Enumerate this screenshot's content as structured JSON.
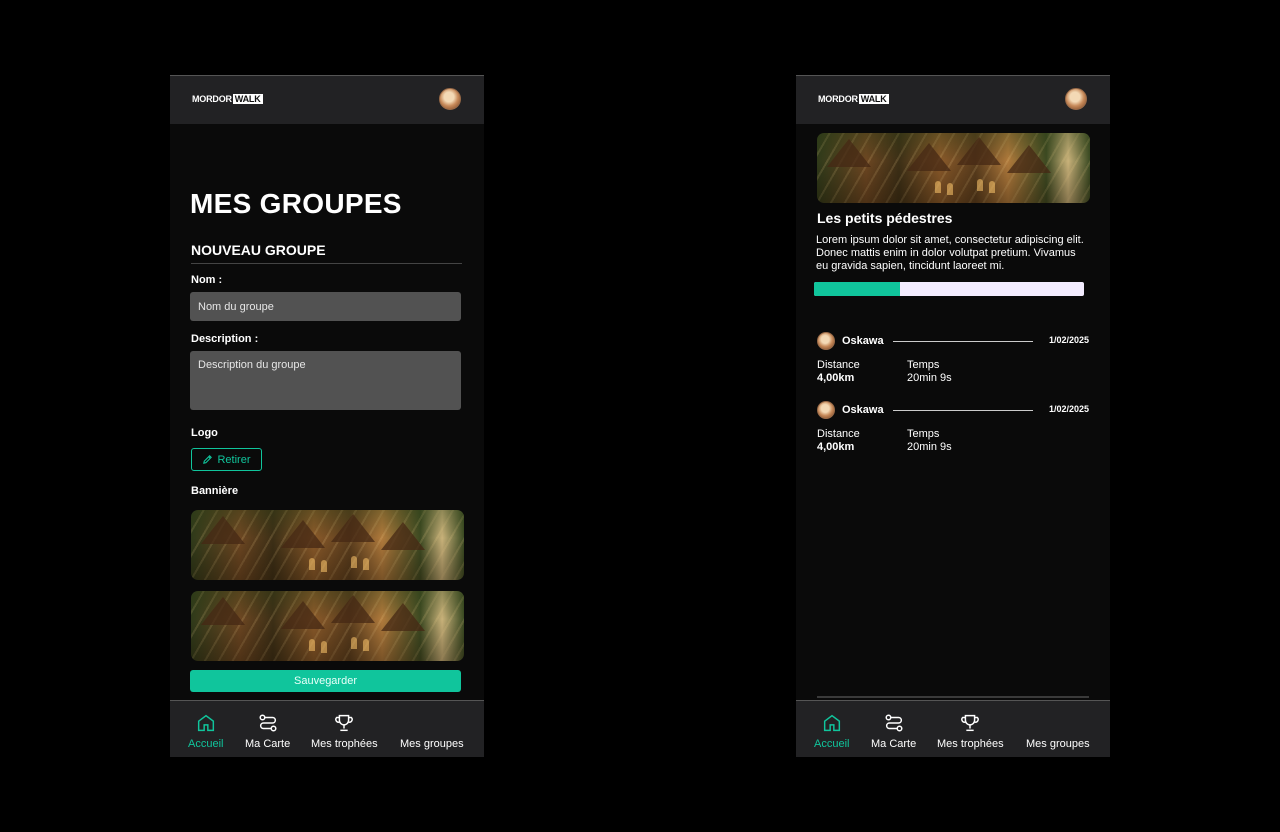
{
  "brand": {
    "logo_left": "MORDOR",
    "logo_right": "WALK"
  },
  "create_screen": {
    "page_title": "MES GROUPES",
    "section_title": "NOUVEAU GROUPE",
    "name_label": "Nom :",
    "name_placeholder": "Nom du groupe",
    "description_label": "Description :",
    "description_placeholder": "Description du groupe",
    "logo_label": "Logo",
    "remove_button": "Retirer",
    "banner_label": "Bannière",
    "save_button": "Sauvegarder"
  },
  "detail_screen": {
    "group_name": "Les petits pédestres",
    "group_description": "Lorem ipsum dolor sit amet, consectetur adipiscing elit. Donec mattis  enim in dolor volutpat pretium. Vivamus eu gravida sapien, tincidunt  laoreet mi.",
    "progress": 0.32,
    "entries": [
      {
        "user": "Oskawa",
        "date": "1/02/2025",
        "distance_label": "Distance",
        "distance": "4,00km",
        "time_label": "Temps",
        "time": "20min 9s"
      },
      {
        "user": "Oskawa",
        "date": "1/02/2025",
        "distance_label": "Distance",
        "distance": "4,00km",
        "time_label": "Temps",
        "time": "20min 9s"
      }
    ]
  },
  "nav": {
    "items": [
      {
        "label": "Accueil",
        "icon": "home-icon",
        "active": true
      },
      {
        "label": "Ma Carte",
        "icon": "route-icon",
        "active": false
      },
      {
        "label": "Mes trophées",
        "icon": "trophy-icon",
        "active": false
      },
      {
        "label": "Mes groupes",
        "icon": "",
        "active": false
      }
    ]
  },
  "colors": {
    "accent": "#10c59c",
    "header": "#222224",
    "input": "#525252",
    "progress_track": "#f3ecff"
  }
}
